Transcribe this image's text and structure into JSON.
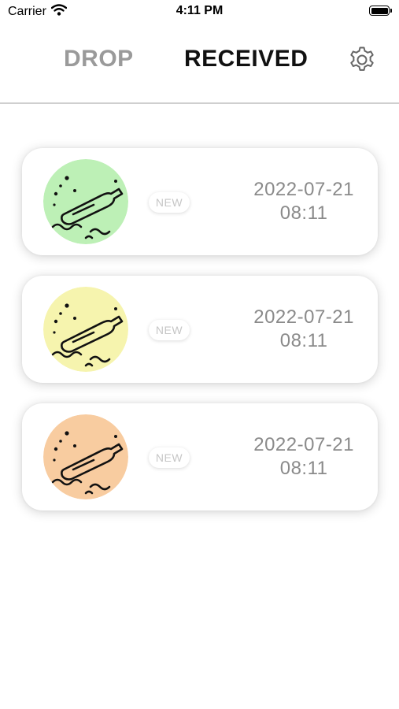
{
  "status_bar": {
    "carrier": "Carrier",
    "time": "4:11 PM",
    "icons": [
      "wifi-icon",
      "battery-icon"
    ]
  },
  "header": {
    "tabs": [
      {
        "label": "DROP",
        "active": false
      },
      {
        "label": "RECEIVED",
        "active": true
      }
    ],
    "settings_icon": "gear-icon"
  },
  "messages": [
    {
      "badge": "NEW",
      "date": "2022-07-21",
      "time": "08:11",
      "icon": "bottle-in-water-icon",
      "color": "#bdf0b6"
    },
    {
      "badge": "NEW",
      "date": "2022-07-21",
      "time": "08:11",
      "icon": "bottle-in-water-icon",
      "color": "#f6f4ae"
    },
    {
      "badge": "NEW",
      "date": "2022-07-21",
      "time": "08:11",
      "icon": "bottle-in-water-icon",
      "color": "#f8cca0"
    }
  ],
  "colors": {
    "active_tab": "#111111",
    "inactive_tab": "#9a9a9a",
    "timestamp": "#8a8a8a",
    "divider": "#cfcfcf"
  }
}
